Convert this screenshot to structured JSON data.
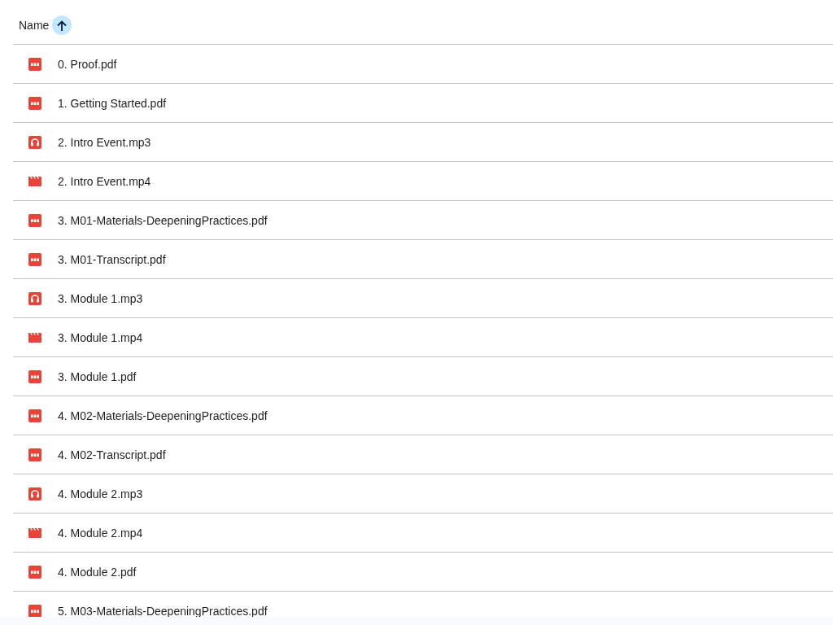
{
  "header": {
    "column_label": "Name",
    "sort_ascending": true
  },
  "files": [
    {
      "name": "0. Proof.pdf",
      "kind": "pdf"
    },
    {
      "name": "1. Getting Started.pdf",
      "kind": "pdf"
    },
    {
      "name": "2. Intro Event.mp3",
      "kind": "audio"
    },
    {
      "name": "2. Intro Event.mp4",
      "kind": "video"
    },
    {
      "name": "3. M01-Materials-DeepeningPractices.pdf",
      "kind": "pdf"
    },
    {
      "name": "3. M01-Transcript.pdf",
      "kind": "pdf"
    },
    {
      "name": "3. Module 1.mp3",
      "kind": "audio"
    },
    {
      "name": "3. Module 1.mp4",
      "kind": "video"
    },
    {
      "name": "3. Module 1.pdf",
      "kind": "pdf"
    },
    {
      "name": "4. M02-Materials-DeepeningPractices.pdf",
      "kind": "pdf"
    },
    {
      "name": "4. M02-Transcript.pdf",
      "kind": "pdf"
    },
    {
      "name": "4. Module 2.mp3",
      "kind": "audio"
    },
    {
      "name": "4. Module 2.mp4",
      "kind": "video"
    },
    {
      "name": "4. Module 2.pdf",
      "kind": "pdf"
    },
    {
      "name": "5. M03-Materials-DeepeningPractices.pdf",
      "kind": "pdf"
    }
  ]
}
